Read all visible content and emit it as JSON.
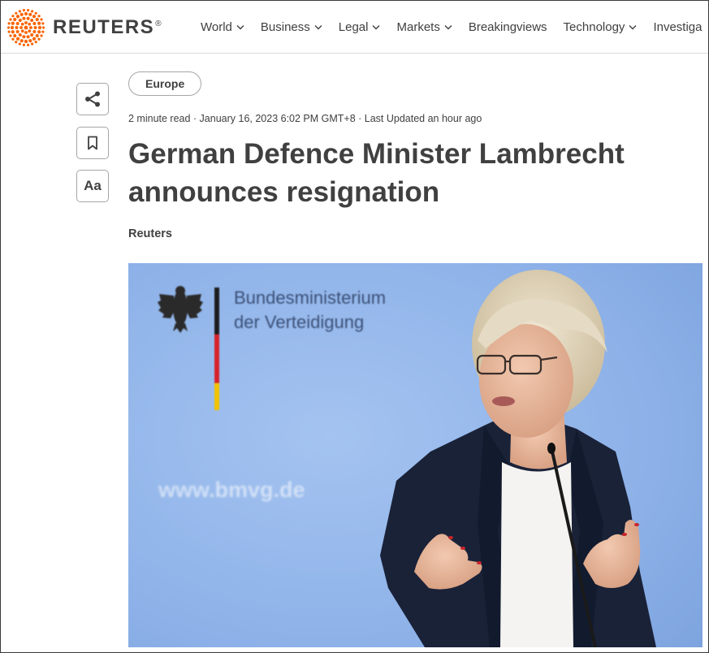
{
  "header": {
    "logo_text": "REUTERS",
    "logo_reg": "®",
    "nav": [
      {
        "label": "World",
        "has_menu": true
      },
      {
        "label": "Business",
        "has_menu": true
      },
      {
        "label": "Legal",
        "has_menu": true
      },
      {
        "label": "Markets",
        "has_menu": true
      },
      {
        "label": "Breakingviews",
        "has_menu": false
      },
      {
        "label": "Technology",
        "has_menu": true
      },
      {
        "label": "Investiga",
        "has_menu": false
      }
    ]
  },
  "tools": {
    "share_icon": "share-icon",
    "bookmark_icon": "bookmark-icon",
    "font_label": "Aa"
  },
  "article": {
    "section_tag": "Europe",
    "meta": "2 minute read · January 16, 2023 6:02 PM GMT+8 · Last Updated an hour ago",
    "headline": "German Defence Minister Lambrecht announces resignation",
    "byline": "Reuters",
    "photo": {
      "backdrop_line1": "Bundesministerium",
      "backdrop_line2": "der Verteidigung",
      "backdrop_url": "www.bmvg.de"
    }
  },
  "colors": {
    "logo_orange": "#fa6400",
    "text": "#404040",
    "backdrop_blue": "#8fb3e9",
    "flag_black": "#1a1a1a",
    "flag_red": "#d8232a",
    "flag_gold": "#f2c300"
  }
}
